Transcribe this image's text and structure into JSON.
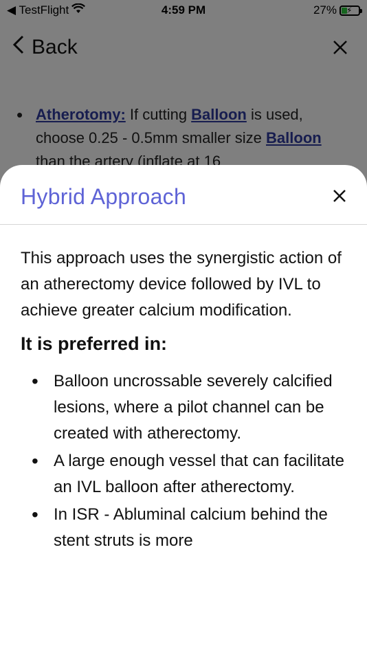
{
  "status_bar": {
    "app_back": "◀ TestFlight",
    "time": "4:59 PM",
    "battery": "27%"
  },
  "nav": {
    "back_label": "Back"
  },
  "background": {
    "item1_link1": "Atherotomy:",
    "item1_text1": " If cutting ",
    "item1_link2": "Balloon",
    "item1_text2": " is used, choose 0.25 - 0.5mm smaller size ",
    "item1_link3": "Balloon",
    "item1_text3": " than the artery (inflate at 16"
  },
  "sheet": {
    "title": "Hybrid Approach",
    "intro": "This approach uses the synergistic action of an atherectomy device followed by IVL to achieve greater calcium modification.",
    "sub_heading": "It is preferred in:",
    "items": [
      "Balloon uncrossable severely calcified lesions, where a pilot channel can be created with atherectomy.",
      "A large enough vessel that can facilitate an IVL balloon after atherectomy.",
      "In ISR - Abluminal calcium behind the stent struts is more"
    ]
  },
  "colors": {
    "title_accent": "#5e63d6",
    "link": "#2e3a9e",
    "battery_fill": "#2ecc40"
  }
}
